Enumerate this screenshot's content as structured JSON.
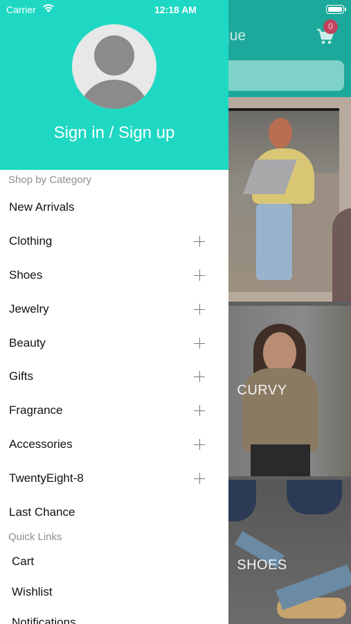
{
  "status_bar": {
    "carrier": "Carrier",
    "time": "12:18 AM"
  },
  "background": {
    "title_partial": "que",
    "cart_badge": "0",
    "tiles": [
      {
        "label": ""
      },
      {
        "label": "CURVY"
      },
      {
        "label": "SHOES"
      }
    ]
  },
  "drawer": {
    "sign_in_label": "Sign in / Sign up",
    "shop_section_label": "Shop by Category",
    "categories": [
      {
        "label": "New Arrivals",
        "expandable": false
      },
      {
        "label": "Clothing",
        "expandable": true
      },
      {
        "label": "Shoes",
        "expandable": true
      },
      {
        "label": "Jewelry",
        "expandable": true
      },
      {
        "label": "Beauty",
        "expandable": true
      },
      {
        "label": "Gifts",
        "expandable": true
      },
      {
        "label": "Fragrance",
        "expandable": true
      },
      {
        "label": "Accessories",
        "expandable": true
      },
      {
        "label": "TwentyEight-8",
        "expandable": true
      },
      {
        "label": "Last Chance",
        "expandable": false
      }
    ],
    "quick_section_label": "Quick Links",
    "quick_links": [
      {
        "label": "Cart"
      },
      {
        "label": "Wishlist"
      },
      {
        "label": "Notifications"
      }
    ]
  },
  "colors": {
    "drawer_header": "#1fd8c3",
    "app_header": "#1ca89a",
    "cart_badge": "#c2425e"
  }
}
